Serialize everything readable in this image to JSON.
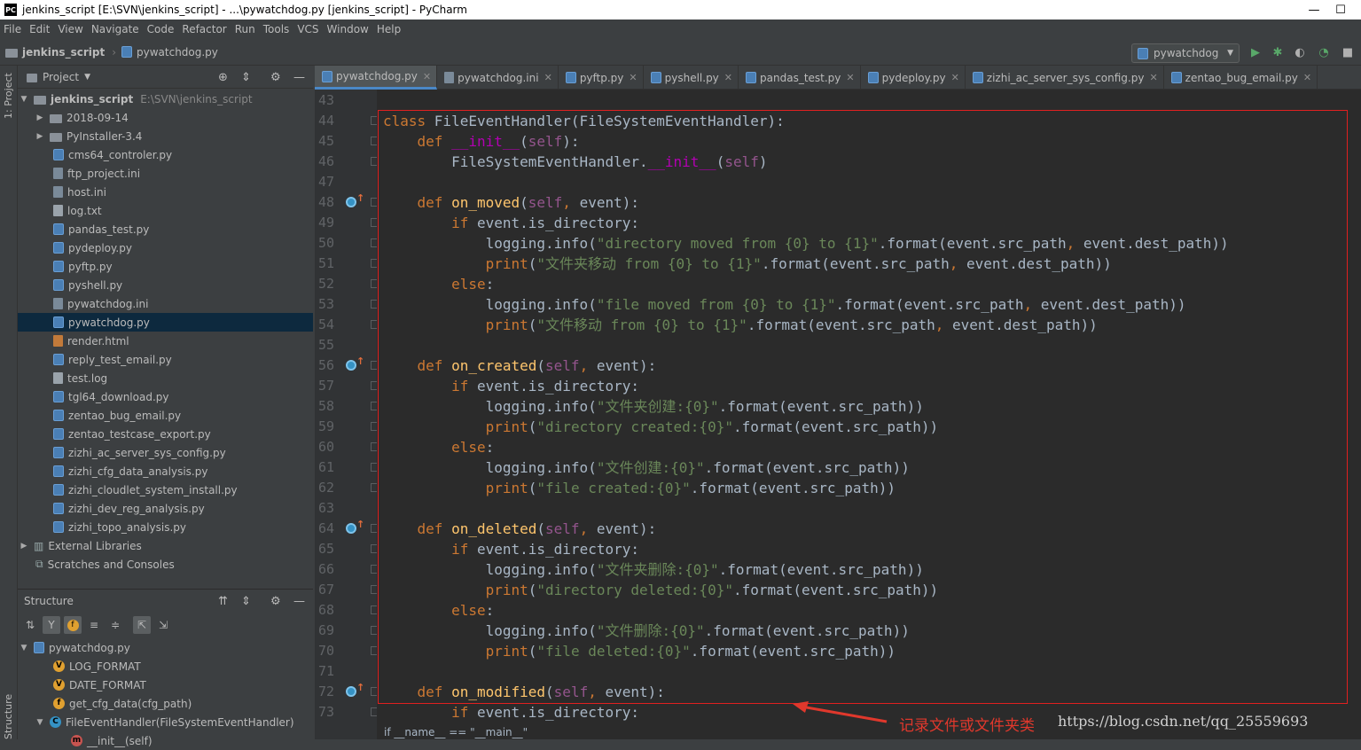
{
  "window": {
    "title": "jenkins_script [E:\\SVN\\jenkins_script] - ...\\pywatchdog.py [jenkins_script] - PyCharm",
    "app_badge": "PC"
  },
  "menu": [
    "File",
    "Edit",
    "View",
    "Navigate",
    "Code",
    "Refactor",
    "Run",
    "Tools",
    "VCS",
    "Window",
    "Help"
  ],
  "breadcrumb": {
    "project": "jenkins_script",
    "file": "pywatchdog.py"
  },
  "run_config": "pywatchdog",
  "side_strip": {
    "project_label": "1: Project",
    "structure_label": "Structure"
  },
  "project_panel": {
    "title": "Project",
    "root": "jenkins_script",
    "root_path": "E:\\SVN\\jenkins_script",
    "items": [
      {
        "label": "2018-09-14",
        "kind": "folder"
      },
      {
        "label": "PyInstaller-3.4",
        "kind": "folder"
      },
      {
        "label": "cms64_controler.py",
        "kind": "py"
      },
      {
        "label": "ftp_project.ini",
        "kind": "ini"
      },
      {
        "label": "host.ini",
        "kind": "ini"
      },
      {
        "label": "log.txt",
        "kind": "txt"
      },
      {
        "label": "pandas_test.py",
        "kind": "py"
      },
      {
        "label": "pydeploy.py",
        "kind": "py"
      },
      {
        "label": "pyftp.py",
        "kind": "py"
      },
      {
        "label": "pyshell.py",
        "kind": "py"
      },
      {
        "label": "pywatchdog.ini",
        "kind": "ini"
      },
      {
        "label": "pywatchdog.py",
        "kind": "py"
      },
      {
        "label": "render.html",
        "kind": "html"
      },
      {
        "label": "reply_test_email.py",
        "kind": "py"
      },
      {
        "label": "test.log",
        "kind": "txt"
      },
      {
        "label": "tgl64_download.py",
        "kind": "py"
      },
      {
        "label": "zentao_bug_email.py",
        "kind": "py"
      },
      {
        "label": "zentao_testcase_export.py",
        "kind": "py"
      },
      {
        "label": "zizhi_ac_server_sys_config.py",
        "kind": "py"
      },
      {
        "label": "zizhi_cfg_data_analysis.py",
        "kind": "py"
      },
      {
        "label": "zizhi_cloudlet_system_install.py",
        "kind": "py"
      },
      {
        "label": "zizhi_dev_reg_analysis.py",
        "kind": "py"
      },
      {
        "label": "zizhi_topo_analysis.py",
        "kind": "py"
      }
    ],
    "external": "External Libraries",
    "scratches": "Scratches and Consoles"
  },
  "structure_panel": {
    "title": "Structure",
    "root": "pywatchdog.py",
    "items": [
      {
        "label": "LOG_FORMAT",
        "badge": "V",
        "color": "#e0a030"
      },
      {
        "label": "DATE_FORMAT",
        "badge": "V",
        "color": "#e0a030"
      },
      {
        "label": "get_cfg_data(cfg_path)",
        "badge": "f",
        "color": "#e0a030"
      },
      {
        "label": "FileEventHandler(FileSystemEventHandler)",
        "badge": "C",
        "color": "#3592c4"
      },
      {
        "label": "__init__(self)",
        "badge": "m",
        "color": "#c75450"
      }
    ]
  },
  "tabs": [
    "pywatchdog.py",
    "pywatchdog.ini",
    "pyftp.py",
    "pyshell.py",
    "pandas_test.py",
    "pydeploy.py",
    "zizhi_ac_server_sys_config.py",
    "zentao_bug_email.py"
  ],
  "line_numbers": [
    "43",
    "44",
    "45",
    "46",
    "47",
    "48",
    "49",
    "50",
    "51",
    "52",
    "53",
    "54",
    "55",
    "56",
    "57",
    "58",
    "59",
    "60",
    "61",
    "62",
    "63",
    "64",
    "65",
    "66",
    "67",
    "68",
    "69",
    "70",
    "71",
    "72",
    "73"
  ],
  "code": [
    [],
    [
      [
        "kw",
        "class "
      ],
      [
        "",
        "FileEventHandler(FileSystemEventHandler):"
      ]
    ],
    [
      [
        "",
        "    "
      ],
      [
        "kw",
        "def "
      ],
      [
        "mg",
        "__init__"
      ],
      [
        "",
        "("
      ],
      [
        "sf",
        "self"
      ],
      [
        "",
        "):"
      ]
    ],
    [
      [
        "",
        "        FileSystemEventHandler."
      ],
      [
        "mg",
        "__init__"
      ],
      [
        "",
        "("
      ],
      [
        "sf",
        "self"
      ],
      [
        "",
        ")"
      ]
    ],
    [],
    [
      [
        "",
        "    "
      ],
      [
        "kw",
        "def "
      ],
      [
        "fn",
        "on_moved"
      ],
      [
        "",
        "("
      ],
      [
        "sf",
        "self"
      ],
      [
        "kw",
        ", "
      ],
      [
        "",
        "event):"
      ]
    ],
    [
      [
        "",
        "        "
      ],
      [
        "kw",
        "if "
      ],
      [
        "",
        "event.is_directory:"
      ]
    ],
    [
      [
        "",
        "            logging.info("
      ],
      [
        "st",
        "\"directory moved from {0} to {1}\""
      ],
      [
        "",
        ".format(event.src_path"
      ],
      [
        "kw",
        ", "
      ],
      [
        "",
        "event.dest_path))"
      ]
    ],
    [
      [
        "",
        "            "
      ],
      [
        "kw",
        "print"
      ],
      [
        "",
        "("
      ],
      [
        "st",
        "\"文件夹移动 from {0} to {1}\""
      ],
      [
        "",
        ".format(event.src_path"
      ],
      [
        "kw",
        ", "
      ],
      [
        "",
        "event.dest_path))"
      ]
    ],
    [
      [
        "",
        "        "
      ],
      [
        "kw",
        "else"
      ],
      [
        "",
        ":"
      ]
    ],
    [
      [
        "",
        "            logging.info("
      ],
      [
        "st",
        "\"file moved from {0} to {1}\""
      ],
      [
        "",
        ".format(event.src_path"
      ],
      [
        "kw",
        ", "
      ],
      [
        "",
        "event.dest_path))"
      ]
    ],
    [
      [
        "",
        "            "
      ],
      [
        "kw",
        "print"
      ],
      [
        "",
        "("
      ],
      [
        "st",
        "\"文件移动 from {0} to {1}\""
      ],
      [
        "",
        ".format(event.src_path"
      ],
      [
        "kw",
        ", "
      ],
      [
        "",
        "event.dest_path))"
      ]
    ],
    [],
    [
      [
        "",
        "    "
      ],
      [
        "kw",
        "def "
      ],
      [
        "fn",
        "on_created"
      ],
      [
        "",
        "("
      ],
      [
        "sf",
        "self"
      ],
      [
        "kw",
        ", "
      ],
      [
        "",
        "event):"
      ]
    ],
    [
      [
        "",
        "        "
      ],
      [
        "kw",
        "if "
      ],
      [
        "",
        "event.is_directory:"
      ]
    ],
    [
      [
        "",
        "            logging.info("
      ],
      [
        "st",
        "\"文件夹创建:{0}\""
      ],
      [
        "",
        ".format(event.src_path))"
      ]
    ],
    [
      [
        "",
        "            "
      ],
      [
        "kw",
        "print"
      ],
      [
        "",
        "("
      ],
      [
        "st",
        "\"directory created:{0}\""
      ],
      [
        "",
        ".format(event.src_path))"
      ]
    ],
    [
      [
        "",
        "        "
      ],
      [
        "kw",
        "else"
      ],
      [
        "",
        ":"
      ]
    ],
    [
      [
        "",
        "            logging.info("
      ],
      [
        "st",
        "\"文件创建:{0}\""
      ],
      [
        "",
        ".format(event.src_path))"
      ]
    ],
    [
      [
        "",
        "            "
      ],
      [
        "kw",
        "print"
      ],
      [
        "",
        "("
      ],
      [
        "st",
        "\"file created:{0}\""
      ],
      [
        "",
        ".format(event.src_path))"
      ]
    ],
    [],
    [
      [
        "",
        "    "
      ],
      [
        "kw",
        "def "
      ],
      [
        "fn",
        "on_deleted"
      ],
      [
        "",
        "("
      ],
      [
        "sf",
        "self"
      ],
      [
        "kw",
        ", "
      ],
      [
        "",
        "event):"
      ]
    ],
    [
      [
        "",
        "        "
      ],
      [
        "kw",
        "if "
      ],
      [
        "",
        "event.is_directory:"
      ]
    ],
    [
      [
        "",
        "            logging.info("
      ],
      [
        "st",
        "\"文件夹删除:{0}\""
      ],
      [
        "",
        ".format(event.src_path))"
      ]
    ],
    [
      [
        "",
        "            "
      ],
      [
        "kw",
        "print"
      ],
      [
        "",
        "("
      ],
      [
        "st",
        "\"directory deleted:{0}\""
      ],
      [
        "",
        ".format(event.src_path))"
      ]
    ],
    [
      [
        "",
        "        "
      ],
      [
        "kw",
        "else"
      ],
      [
        "",
        ":"
      ]
    ],
    [
      [
        "",
        "            logging.info("
      ],
      [
        "st",
        "\"文件删除:{0}\""
      ],
      [
        "",
        ".format(event.src_path))"
      ]
    ],
    [
      [
        "",
        "            "
      ],
      [
        "kw",
        "print"
      ],
      [
        "",
        "("
      ],
      [
        "st",
        "\"file deleted:{0}\""
      ],
      [
        "",
        ".format(event.src_path))"
      ]
    ],
    [],
    [
      [
        "",
        "    "
      ],
      [
        "kw",
        "def "
      ],
      [
        "fn",
        "on_modified"
      ],
      [
        "",
        "("
      ],
      [
        "sf",
        "self"
      ],
      [
        "kw",
        ", "
      ],
      [
        "",
        "event):"
      ]
    ],
    [
      [
        "",
        "        "
      ],
      [
        "kw",
        "if "
      ],
      [
        "",
        "event.is_directory:"
      ]
    ]
  ],
  "override_lines": [
    "48",
    "56",
    "64",
    "72"
  ],
  "bottom_hint": "if __name__ == \"__main__\"",
  "annotation": "记录文件或文件夹类",
  "watermark": "https://blog.csdn.net/qq_25559693",
  "colors": {
    "keyword": "#cc7832",
    "function": "#ffc66d",
    "self": "#94558d",
    "string": "#6a8759",
    "magic": "#b200b2",
    "highlight_box": "#e02020"
  }
}
